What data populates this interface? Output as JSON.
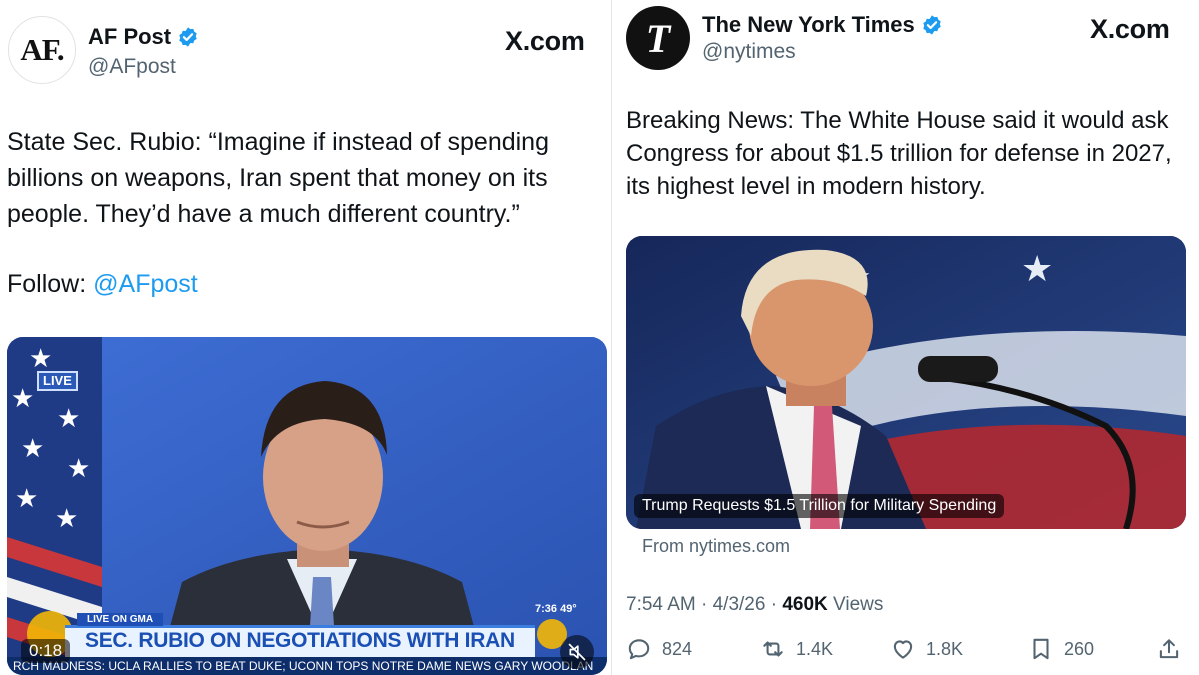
{
  "left_post": {
    "account_name": "AF Post",
    "handle": "@AFpost",
    "avatar_text": "AF.",
    "source_label": "X.com",
    "text": "State Sec. Rubio: “Imagine if instead of spending billions on weapons, Iran spent that money on its people. They’d have a much different country.”",
    "follow_label": "Follow:",
    "follow_mention": "@AFpost",
    "video": {
      "live_badge": "LIVE",
      "duration": "0:18",
      "lower_tag": "LIVE ON GMA",
      "headline": "SEC. RUBIO ON NEGOTIATIONS WITH IRAN",
      "clock": "7:36  49°",
      "ticker": "RCH MADNESS:  UCLA RALLIES TO BEAT DUKE;  UCONN TOPS NOTRE DAME        NEWS        GARY WOODLAN"
    }
  },
  "right_post": {
    "account_name": "The New York Times",
    "handle": "@nytimes",
    "avatar_text": "T",
    "source_label": "X.com",
    "text": "Breaking News: The White House said it would ask Congress for about $1.5 trillion for defense in 2027, its highest level in modern history.",
    "card_caption": "Trump Requests $1.5 Trillion for Military Spending",
    "card_source": "From nytimes.com",
    "meta_time": "7:54 AM · 4/3/26 · ",
    "meta_views_count": "460K",
    "meta_views_label": " Views",
    "actions": {
      "replies": "824",
      "reposts": "1.4K",
      "likes": "1.8K",
      "bookmarks": "260"
    }
  },
  "colors": {
    "link": "#1d9bf0",
    "verified": "#1d9bf0",
    "secondary_text": "#536471"
  }
}
